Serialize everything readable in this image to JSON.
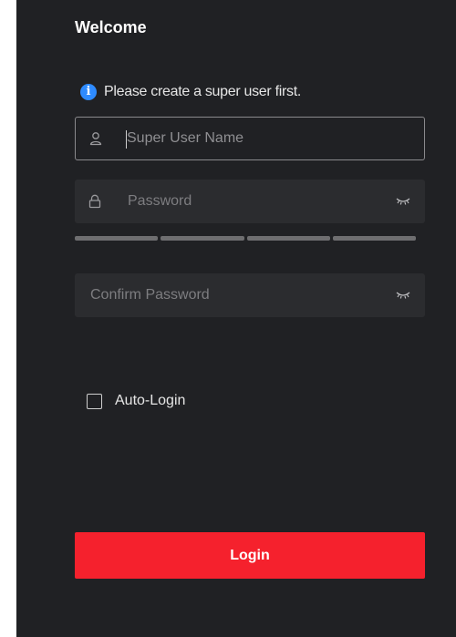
{
  "header": {
    "title": "Welcome"
  },
  "notice": {
    "icon": "info-icon",
    "text": "Please create a super user first."
  },
  "form": {
    "username": {
      "icon": "user-icon",
      "placeholder": "Super User Name",
      "value": ""
    },
    "password": {
      "icon": "lock-icon",
      "placeholder": "Password",
      "value": "",
      "toggle_icon": "eye-closed-icon"
    },
    "strength_meter": {
      "segments": 4,
      "filled": 0
    },
    "confirm_password": {
      "placeholder": "Confirm Password",
      "value": "",
      "toggle_icon": "eye-closed-icon"
    },
    "auto_login": {
      "label": "Auto-Login",
      "checked": false
    },
    "submit_label": "Login"
  },
  "colors": {
    "panel_bg": "#202124",
    "field_bg": "#2b2c2f",
    "accent_red": "#f5212d",
    "info_blue": "#2e8bff"
  }
}
